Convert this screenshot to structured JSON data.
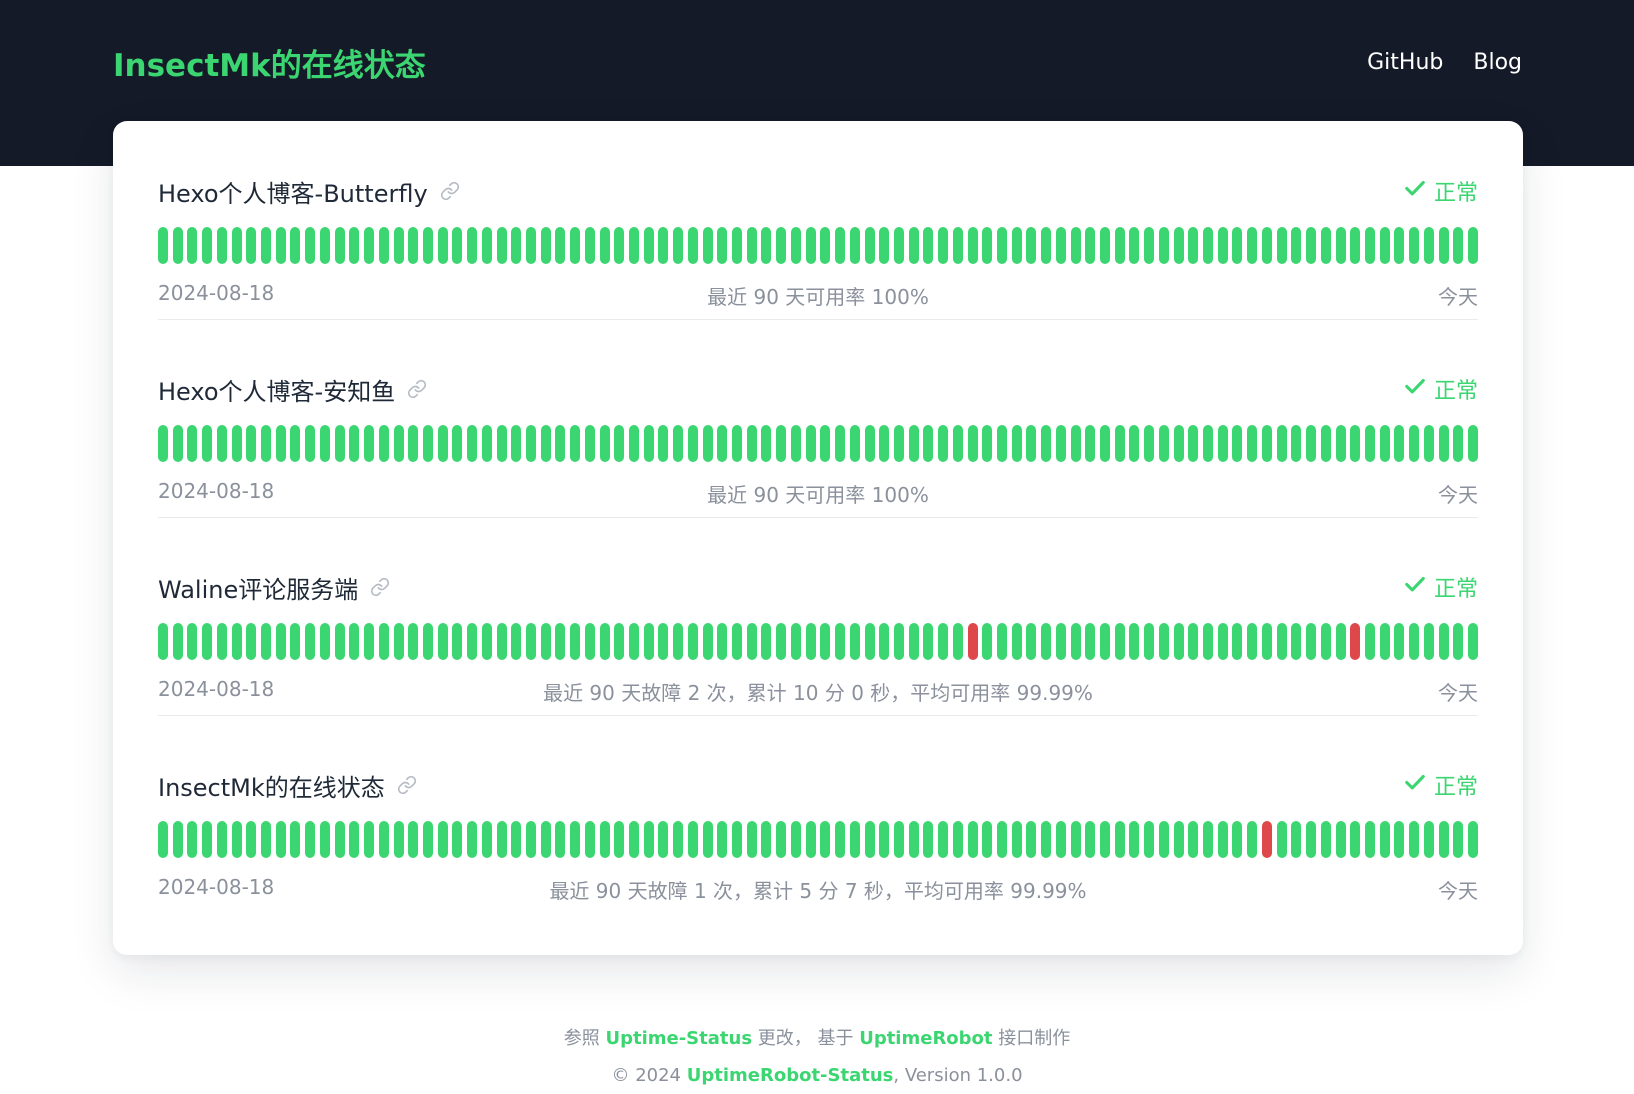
{
  "header": {
    "title": "InsectMk的在线状态",
    "nav": [
      {
        "label": "GitHub"
      },
      {
        "label": "Blog"
      }
    ]
  },
  "colors": {
    "header_bg": "#141a27",
    "accent": "#3bd671",
    "up": "#3bd671",
    "down": "#de484a",
    "muted": "#8a919c"
  },
  "monitors": [
    {
      "name": "Hexo个人博客-Butterfly",
      "status": "正常",
      "start_date": "2024-08-18",
      "summary": "最近 90 天可用率 100%",
      "end_label": "今天",
      "days": 90,
      "down_days": []
    },
    {
      "name": "Hexo个人博客-安知鱼",
      "status": "正常",
      "start_date": "2024-08-18",
      "summary": "最近 90 天可用率 100%",
      "end_label": "今天",
      "days": 90,
      "down_days": []
    },
    {
      "name": "Waline评论服务端",
      "status": "正常",
      "start_date": "2024-08-18",
      "summary": "最近 90 天故障 2 次，累计 10 分 0 秒，平均可用率 99.99%",
      "end_label": "今天",
      "days": 90,
      "down_days": [
        55,
        81
      ]
    },
    {
      "name": "InsectMk的在线状态",
      "status": "正常",
      "start_date": "2024-08-18",
      "summary": "最近 90 天故障 1 次，累计 5 分 7 秒，平均可用率 99.99%",
      "end_label": "今天",
      "days": 90,
      "down_days": [
        75
      ]
    }
  ],
  "footer": {
    "line1_prefix": "参照 ",
    "line1_link1": "Uptime-Status",
    "line1_mid": " 更改， 基于 ",
    "line1_link2": "UptimeRobot",
    "line1_suffix": " 接口制作",
    "line2_prefix": "© 2024 ",
    "line2_link": "UptimeRobot-Status",
    "line2_suffix": ", Version 1.0.0"
  }
}
